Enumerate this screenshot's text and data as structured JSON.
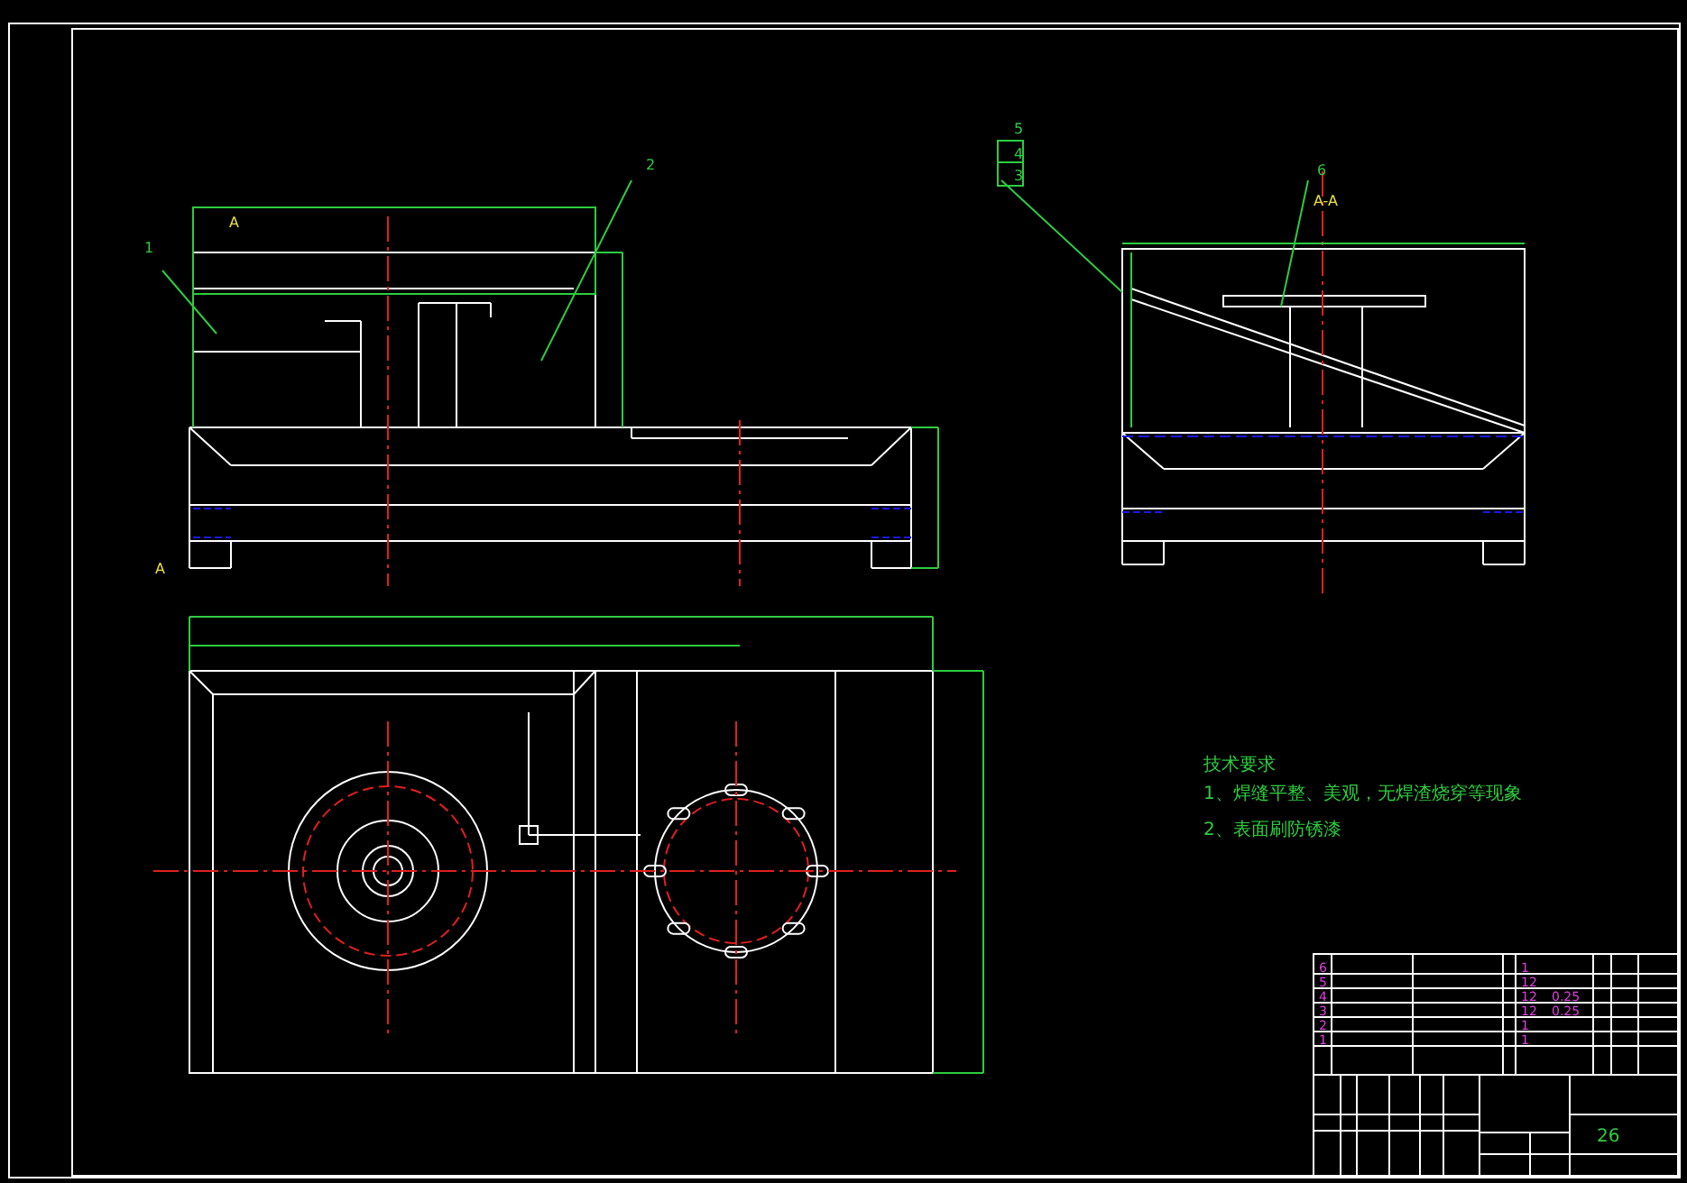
{
  "drawing": {
    "balloons": [
      {
        "text": "1"
      },
      {
        "text": "2"
      },
      {
        "text": "6"
      },
      {
        "text": "5"
      },
      {
        "text": "4"
      },
      {
        "text": "3"
      }
    ],
    "section_labels": [
      {
        "text": "A"
      },
      {
        "text": "A"
      },
      {
        "text": "A-A"
      }
    ],
    "technical_requirements": {
      "title": "技术要求",
      "items": [
        "1、焊缝平整、美观，无焊渣烧穿等现象",
        "2、表面刷防锈漆"
      ]
    },
    "parts_list": [
      {
        "no": "6",
        "qty": "1"
      },
      {
        "no": "5",
        "qty": "12"
      },
      {
        "no": "4",
        "qty": "12",
        "weight": "0.25"
      },
      {
        "no": "3",
        "qty": "12",
        "weight": "0.25"
      },
      {
        "no": "2",
        "qty": "1"
      },
      {
        "no": "1",
        "qty": "1"
      }
    ],
    "title_block": {
      "sheet": "26"
    }
  }
}
